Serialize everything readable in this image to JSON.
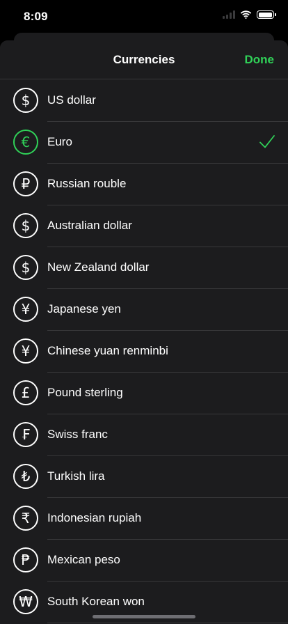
{
  "status_bar": {
    "time": "8:09"
  },
  "sheet": {
    "title": "Currencies",
    "done_label": "Done"
  },
  "colors": {
    "accent": "#30d158",
    "background": "#1c1c1e",
    "separator": "#38383a"
  },
  "currencies": [
    {
      "name": "US dollar",
      "icon": "dollar-sign-icon",
      "symbol": "$",
      "selected": false
    },
    {
      "name": "Euro",
      "icon": "euro-sign-icon",
      "symbol": "€",
      "selected": true
    },
    {
      "name": "Russian rouble",
      "icon": "ruble-sign-icon",
      "symbol": "₽",
      "selected": false
    },
    {
      "name": "Australian dollar",
      "icon": "dollar-sign-icon",
      "symbol": "$",
      "selected": false
    },
    {
      "name": "New Zealand dollar",
      "icon": "dollar-sign-icon",
      "symbol": "$",
      "selected": false
    },
    {
      "name": "Japanese yen",
      "icon": "yen-sign-icon",
      "symbol": "¥",
      "selected": false
    },
    {
      "name": "Chinese yuan renminbi",
      "icon": "yuan-sign-icon",
      "symbol": "¥",
      "selected": false
    },
    {
      "name": "Pound sterling",
      "icon": "pound-sign-icon",
      "symbol": "£",
      "selected": false
    },
    {
      "name": "Swiss franc",
      "icon": "franc-sign-icon",
      "symbol": "₣",
      "selected": false
    },
    {
      "name": "Turkish lira",
      "icon": "lira-sign-icon",
      "symbol": "₺",
      "selected": false
    },
    {
      "name": "Indonesian rupiah",
      "icon": "rupee-sign-icon",
      "symbol": "₹",
      "selected": false
    },
    {
      "name": "Mexican peso",
      "icon": "peso-sign-icon",
      "symbol": "₱",
      "selected": false
    },
    {
      "name": "South Korean won",
      "icon": "won-sign-icon",
      "symbol": "₩",
      "selected": false
    }
  ]
}
